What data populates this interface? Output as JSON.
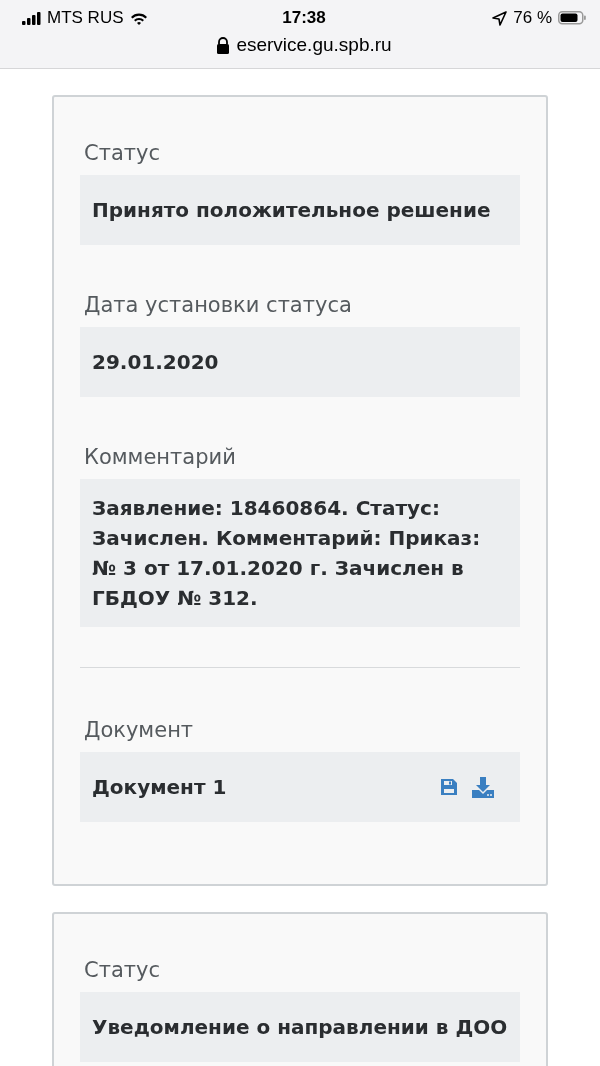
{
  "status_bar": {
    "carrier": "MTS RUS",
    "time": "17:38",
    "battery": "76 %"
  },
  "address_bar": {
    "url": "eservice.gu.spb.ru"
  },
  "cards": [
    {
      "fields": [
        {
          "kind": "field",
          "label": "Статус",
          "value": "Принято положительное решение"
        },
        {
          "kind": "field",
          "label": "Дата установки статуса",
          "value": "29.01.2020"
        },
        {
          "kind": "field",
          "label": "Комментарий",
          "value": "Заявление: 18460864. Статус: Зачислен. Комментарий: Приказ: № 3 от 17.01.2020 г. Зачислен в ГБДОУ № 312."
        },
        {
          "kind": "divider"
        },
        {
          "kind": "document",
          "label": "Документ",
          "value": "Документ 1"
        }
      ]
    },
    {
      "fields": [
        {
          "kind": "field",
          "label": "Статус",
          "value": "Уведомление о направлении в ДОО"
        }
      ]
    }
  ]
}
